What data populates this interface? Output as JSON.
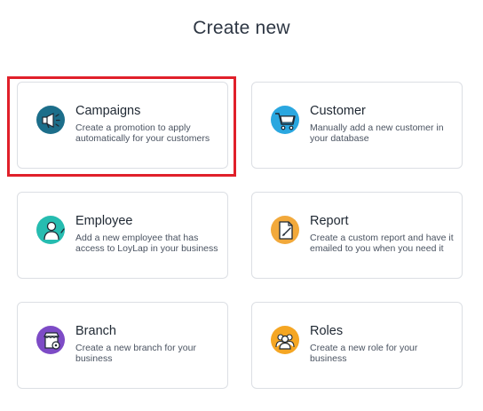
{
  "page": {
    "title": "Create new"
  },
  "cards": [
    {
      "name": "Campaigns",
      "description": "Create a promotion to apply automatically for your customers",
      "icon": "megaphone-icon",
      "color": "#1c6e8a"
    },
    {
      "name": "Customer",
      "description": "Manually add a new customer in your database",
      "icon": "shopping-cart-icon",
      "color": "#2aa7e0"
    },
    {
      "name": "Employee",
      "description": "Add a new employee that has access to LoyLap in your business",
      "icon": "employee-icon",
      "color": "#26bcb0"
    },
    {
      "name": "Report",
      "description": "Create a custom report and have it emailed to you when you need it",
      "icon": "report-icon",
      "color": "#f2a93b"
    },
    {
      "name": "Branch",
      "description": "Create a new branch for your business",
      "icon": "store-icon",
      "color": "#7d4bc6"
    },
    {
      "name": "Roles",
      "description": "Create a new role for your business",
      "icon": "users-icon",
      "color": "#f5a623"
    }
  ],
  "highlight_color": "#e0202a"
}
